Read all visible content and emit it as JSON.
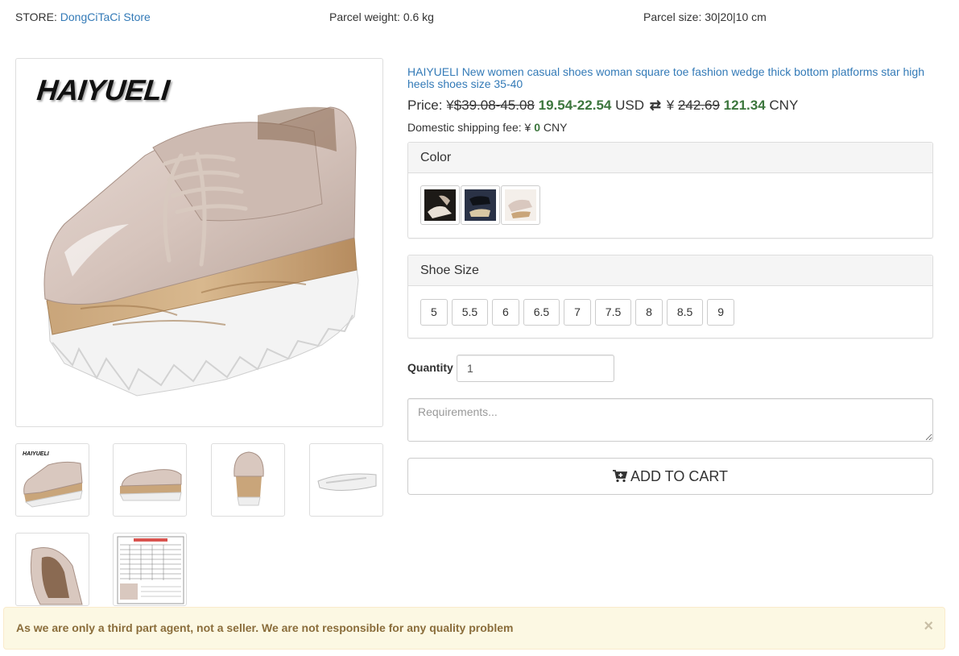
{
  "store": {
    "label": "STORE:",
    "name": "DongCiTaCi Store"
  },
  "parcel": {
    "weight": "Parcel weight: 0.6 kg",
    "size": "Parcel size: 30|20|10 cm"
  },
  "product": {
    "brand": "HAIYUELI",
    "title": "HAIYUELI New women casual shoes woman square toe fashion wedge thick bottom platforms star high heels shoes size 35-40"
  },
  "price": {
    "label": "Price:",
    "usd_symbol": "¥",
    "usd_old": "$39.08-45.08",
    "usd_new": "19.54-22.54",
    "usd_unit": "USD",
    "cny_symbol": "¥",
    "cny_old": "242.69",
    "cny_new": "121.34",
    "cny_unit": "CNY"
  },
  "shipping": {
    "label": "Domestic shipping fee:",
    "symbol": "¥",
    "value": "0",
    "unit": "CNY"
  },
  "color": {
    "label": "Color"
  },
  "size": {
    "label": "Shoe Size",
    "options": [
      "5",
      "5.5",
      "6",
      "6.5",
      "7",
      "7.5",
      "8",
      "8.5",
      "9"
    ]
  },
  "quantity": {
    "label": "Quantity",
    "value": "1"
  },
  "requirements": {
    "placeholder": "Requirements..."
  },
  "cart": {
    "label": "ADD TO CART"
  },
  "alert": {
    "text": "As we are only a third part agent, not a seller. We are not responsible for any quality problem",
    "close": "×"
  },
  "colors": {
    "link": "#337ab7",
    "price_green": "#3c763d",
    "alert_bg": "#fcf8e3",
    "alert_text": "#8a6d3b"
  }
}
